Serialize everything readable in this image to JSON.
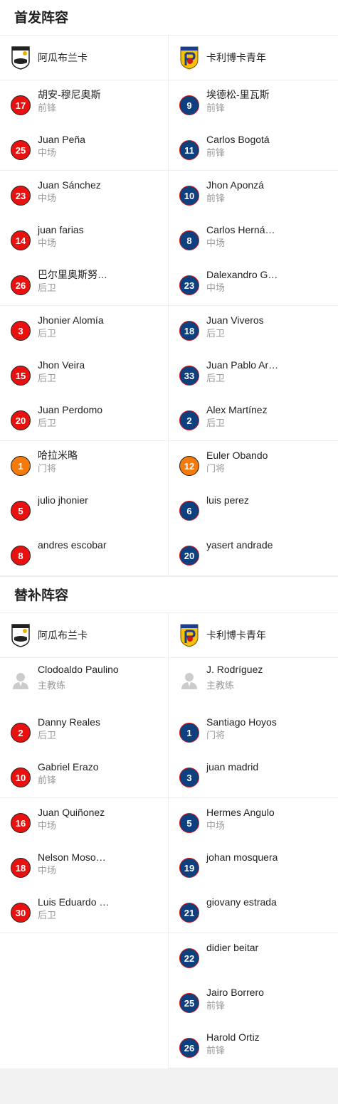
{
  "starting": {
    "title": "首发阵容",
    "home": {
      "name": "阿瓜布兰卡"
    },
    "away": {
      "name": "卡利博卡青年"
    },
    "home_players": [
      {
        "num": "17",
        "name": "胡安-穆尼奥斯",
        "pos": "前锋",
        "color": "red"
      },
      {
        "num": "25",
        "name": "Juan Peña",
        "pos": "中场",
        "color": "red"
      },
      {
        "num": "23",
        "name": "Juan Sánchez",
        "pos": "中场",
        "color": "red"
      },
      {
        "num": "14",
        "name": "juan farias",
        "pos": "中场",
        "color": "red"
      },
      {
        "num": "26",
        "name": "巴尔里奥斯努…",
        "pos": "后卫",
        "color": "red"
      },
      {
        "num": "3",
        "name": "Jhonier Alomía",
        "pos": "后卫",
        "color": "red"
      },
      {
        "num": "15",
        "name": "Jhon Veira",
        "pos": "后卫",
        "color": "red"
      },
      {
        "num": "20",
        "name": "Juan Perdomo",
        "pos": "后卫",
        "color": "red"
      },
      {
        "num": "1",
        "name": "哈拉米略",
        "pos": "门将",
        "color": "orange"
      },
      {
        "num": "5",
        "name": "julio jhonier",
        "pos": "",
        "color": "red"
      },
      {
        "num": "8",
        "name": "andres escobar",
        "pos": "",
        "color": "red"
      }
    ],
    "away_players": [
      {
        "num": "9",
        "name": "埃德松-里瓦斯",
        "pos": "前锋",
        "color": "blue"
      },
      {
        "num": "11",
        "name": "Carlos Bogotá",
        "pos": "前锋",
        "color": "blue"
      },
      {
        "num": "10",
        "name": "Jhon Aponzá",
        "pos": "前锋",
        "color": "blue"
      },
      {
        "num": "8",
        "name": "Carlos Herná…",
        "pos": "中场",
        "color": "blue"
      },
      {
        "num": "23",
        "name": "Dalexandro G…",
        "pos": "中场",
        "color": "blue"
      },
      {
        "num": "18",
        "name": "Juan Viveros",
        "pos": "后卫",
        "color": "blue"
      },
      {
        "num": "33",
        "name": "Juan Pablo Ar…",
        "pos": "后卫",
        "color": "blue"
      },
      {
        "num": "2",
        "name": "Alex Martínez",
        "pos": "后卫",
        "color": "blue"
      },
      {
        "num": "12",
        "name": "Euler Obando",
        "pos": "门将",
        "color": "orange"
      },
      {
        "num": "6",
        "name": "luis perez",
        "pos": "",
        "color": "blue"
      },
      {
        "num": "20",
        "name": "yasert andrade",
        "pos": "",
        "color": "blue"
      }
    ]
  },
  "subs": {
    "title": "替补阵容",
    "home": {
      "name": "阿瓜布兰卡"
    },
    "away": {
      "name": "卡利博卡青年"
    },
    "home_coach": {
      "name": "Clodoaldo Paulino",
      "pos": "主教练"
    },
    "away_coach": {
      "name": "J. Rodríguez",
      "pos": "主教练"
    },
    "home_players": [
      {
        "num": "2",
        "name": "Danny Reales",
        "pos": "后卫",
        "color": "red"
      },
      {
        "num": "10",
        "name": "Gabriel Erazo",
        "pos": "前锋",
        "color": "red"
      },
      {
        "num": "16",
        "name": "Juan Quiñonez",
        "pos": "中场",
        "color": "red"
      },
      {
        "num": "18",
        "name": "Nelson Moso…",
        "pos": "中场",
        "color": "red"
      },
      {
        "num": "30",
        "name": "Luis Eduardo …",
        "pos": "后卫",
        "color": "red"
      }
    ],
    "away_players": [
      {
        "num": "1",
        "name": "Santiago Hoyos",
        "pos": "门将",
        "color": "blue"
      },
      {
        "num": "3",
        "name": "juan madrid",
        "pos": "",
        "color": "blue"
      },
      {
        "num": "5",
        "name": "Hermes Angulo",
        "pos": "中场",
        "color": "blue"
      },
      {
        "num": "19",
        "name": "johan mosquera",
        "pos": "",
        "color": "blue"
      },
      {
        "num": "21",
        "name": "giovany estrada",
        "pos": "",
        "color": "blue"
      },
      {
        "num": "22",
        "name": "didier beitar",
        "pos": "",
        "color": "blue"
      },
      {
        "num": "25",
        "name": "Jairo Borrero",
        "pos": "前锋",
        "color": "blue"
      },
      {
        "num": "26",
        "name": "Harold Ortiz",
        "pos": "前锋",
        "color": "blue"
      }
    ]
  }
}
